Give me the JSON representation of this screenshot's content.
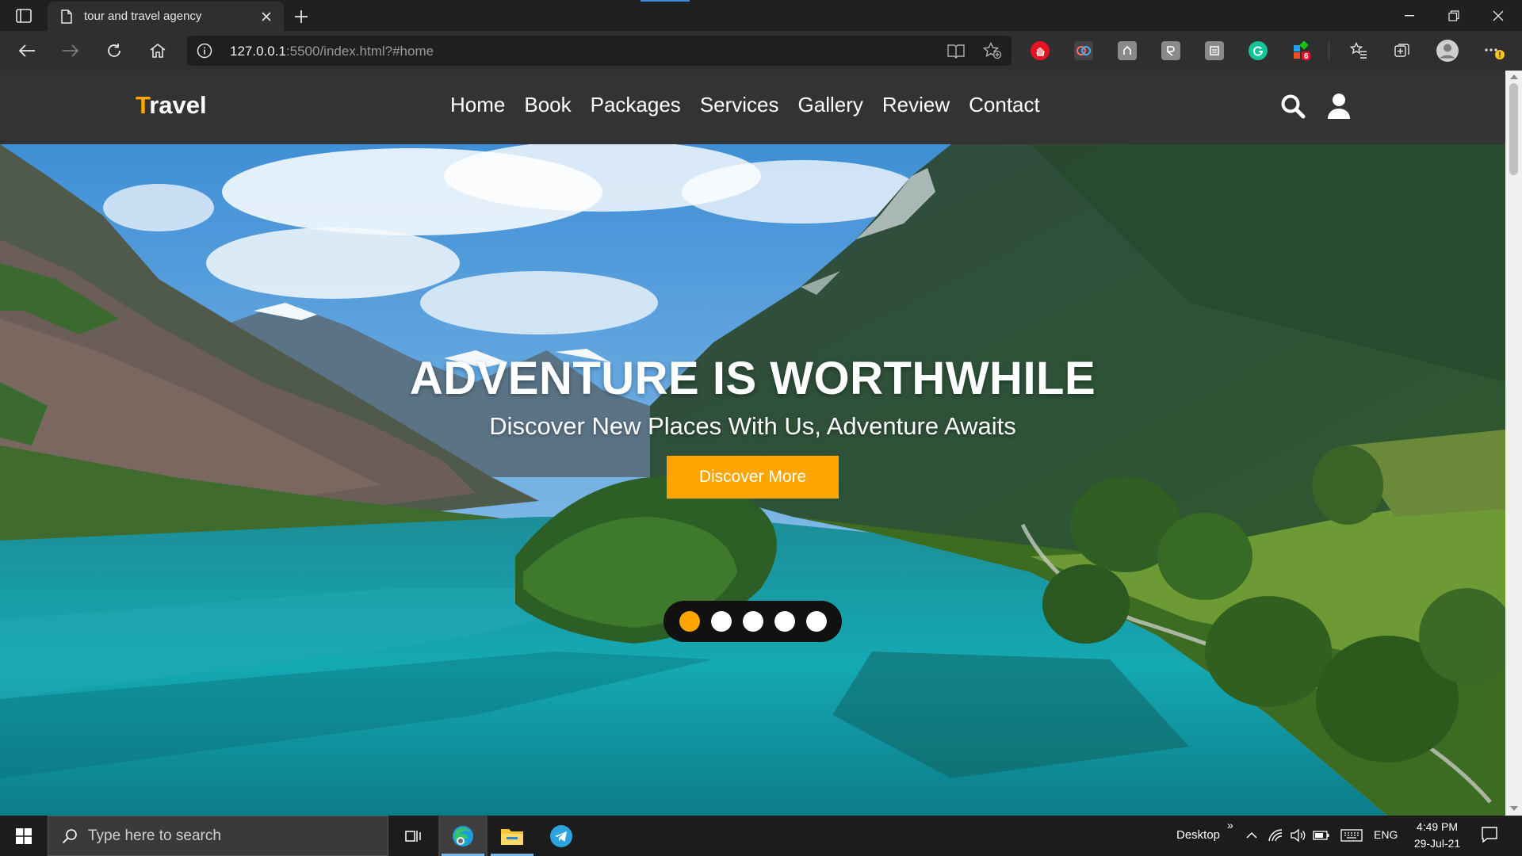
{
  "browser": {
    "tab_title": "tour and travel agency",
    "url_host": "127.0.0.1",
    "url_rest": ":5500/index.html?#home",
    "extension_badge": "6"
  },
  "site": {
    "logo_first_letter": "T",
    "logo_rest": "ravel",
    "nav": [
      "Home",
      "Book",
      "Packages",
      "Services",
      "Gallery",
      "Review",
      "Contact"
    ],
    "colors": {
      "accent": "#ffa500",
      "header_bg": "#333333"
    }
  },
  "hero": {
    "title": "ADVENTURE IS WORTHWHILE",
    "subtitle": "Discover New Places With Us, Adventure Awaits",
    "button_label": "Discover More",
    "slides_count": 5,
    "active_slide": 1
  },
  "taskbar": {
    "search_placeholder": "Type here to search",
    "desktop_label": "Desktop",
    "language": "ENG",
    "time": "4:49 PM",
    "date": "29-Jul-21"
  }
}
